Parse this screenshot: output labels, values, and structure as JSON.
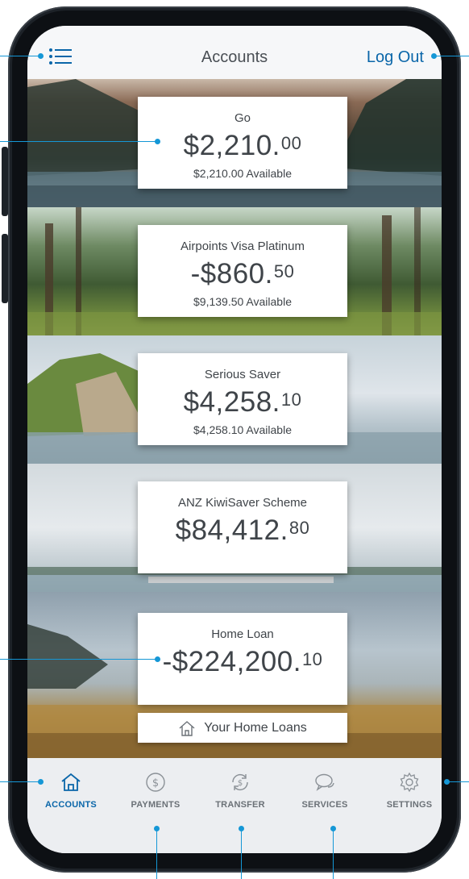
{
  "header": {
    "title": "Accounts",
    "logout_label": "Log Out",
    "menu_icon": "hamburger-list-icon"
  },
  "accounts": [
    {
      "name": "Go",
      "balance_main": "$2,210.",
      "balance_cents": "00",
      "available": "$2,210.00 Available"
    },
    {
      "name": "Airpoints Visa Platinum",
      "balance_main": "-$860.",
      "balance_cents": "50",
      "available": "$9,139.50 Available"
    },
    {
      "name": "Serious Saver",
      "balance_main": "$4,258.",
      "balance_cents": "10",
      "available": "$4,258.10 Available"
    },
    {
      "name": "ANZ KiwiSaver Scheme",
      "balance_main": "$84,412.",
      "balance_cents": "80",
      "available": ""
    },
    {
      "name": "Home Loan",
      "balance_main": "-$224,200.",
      "balance_cents": "10",
      "available": ""
    }
  ],
  "home_loans_button": {
    "label": "Your Home Loans",
    "icon": "house-icon"
  },
  "nav": {
    "items": [
      {
        "label": "ACCOUNTS",
        "icon": "home-icon",
        "active": true
      },
      {
        "label": "PAYMENTS",
        "icon": "dollar-circle-icon",
        "active": false
      },
      {
        "label": "TRANSFER",
        "icon": "transfer-cycle-icon",
        "active": false
      },
      {
        "label": "SERVICES",
        "icon": "speech-bubbles-icon",
        "active": false
      },
      {
        "label": "SETTINGS",
        "icon": "gear-icon",
        "active": false
      }
    ]
  },
  "colors": {
    "accent": "#0a66a9",
    "callout": "#1597d6",
    "nav_inactive": "#6b7177",
    "card_text": "#3f4449"
  }
}
